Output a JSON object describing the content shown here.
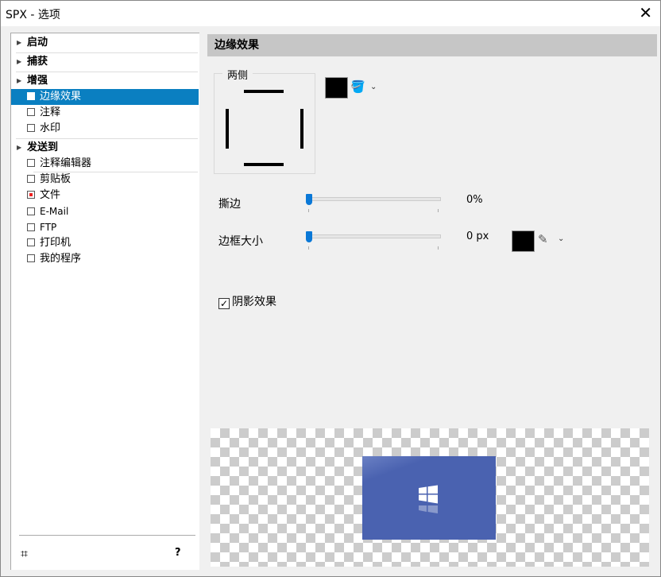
{
  "window": {
    "title": "SPX - 选项",
    "close": "✕"
  },
  "sidebar": {
    "groups": [
      {
        "label": "启动"
      },
      {
        "label": "捕获"
      },
      {
        "label": "增强",
        "items": [
          {
            "label": "边缘效果",
            "selected": true
          },
          {
            "label": "注释"
          },
          {
            "label": "水印"
          }
        ]
      },
      {
        "label": "发送到",
        "items": [
          {
            "label": "注释编辑器"
          },
          {
            "label": "剪贴板"
          },
          {
            "label": "文件",
            "checked": true
          },
          {
            "label": "E-Mail"
          },
          {
            "label": "FTP"
          },
          {
            "label": "打印机"
          },
          {
            "label": "我的程序"
          }
        ]
      }
    ],
    "help": "?"
  },
  "panel": {
    "title": "边缘效果",
    "sides_label": "两侧",
    "fill_color": "#000000",
    "torn_label": "撕边",
    "torn_value": "0%",
    "torn_percent": 0,
    "border_label": "边框大小",
    "border_value": "0 px",
    "border_px": 0,
    "border_color": "#000000",
    "shadow_label": "阴影效果",
    "shadow_checked": true
  },
  "colors": {
    "accent": "#0a7fc1",
    "preview_image": "#4a62b0"
  }
}
